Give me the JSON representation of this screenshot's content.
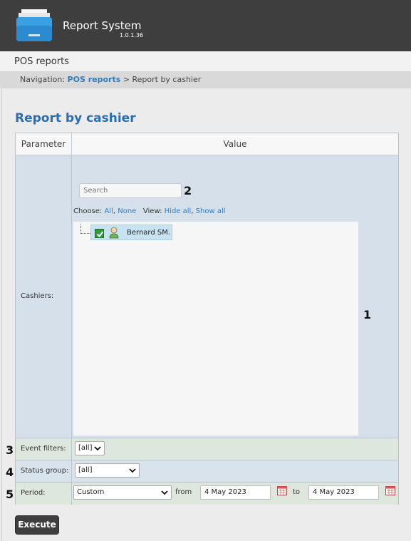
{
  "app": {
    "title": "Report System",
    "version": "1.0.1.36"
  },
  "section": {
    "title": "POS reports"
  },
  "breadcrumb": {
    "prefix": "Navigation:",
    "link": "POS reports",
    "separator": ">",
    "current": "Report by cashier"
  },
  "page": {
    "title": "Report by cashier"
  },
  "table": {
    "param_header": "Parameter",
    "value_header": "Value"
  },
  "cashiers": {
    "label": "Cashiers:",
    "search_placeholder": "Search",
    "choose_label": "Choose:",
    "choose_all": "All",
    "choose_none": "None",
    "view_label": "View:",
    "view_hide_all": "Hide all",
    "view_show_all": "Show all",
    "items": [
      {
        "name": "Bernard SM.",
        "checked": true,
        "icon": "person-icon"
      }
    ]
  },
  "event_filters": {
    "label": "Event filters:",
    "value": "[all]"
  },
  "status_group": {
    "label": "Status group:",
    "value": "[all]"
  },
  "period": {
    "label": "Period:",
    "value": "Custom",
    "from_label": "from",
    "from_date": "4 May 2023",
    "to_label": "to",
    "to_date": "4 May 2023"
  },
  "callouts": {
    "n1": "1",
    "n2": "2",
    "n3": "3",
    "n4": "4",
    "n5": "5"
  },
  "execute_label": "Execute",
  "colors": {
    "topbar": "#3e3e3e",
    "accent_blue": "#2b6db5",
    "link_blue": "#2f7ec1",
    "row_blue": "#d6e0ea",
    "row_green": "#dde7dd"
  }
}
